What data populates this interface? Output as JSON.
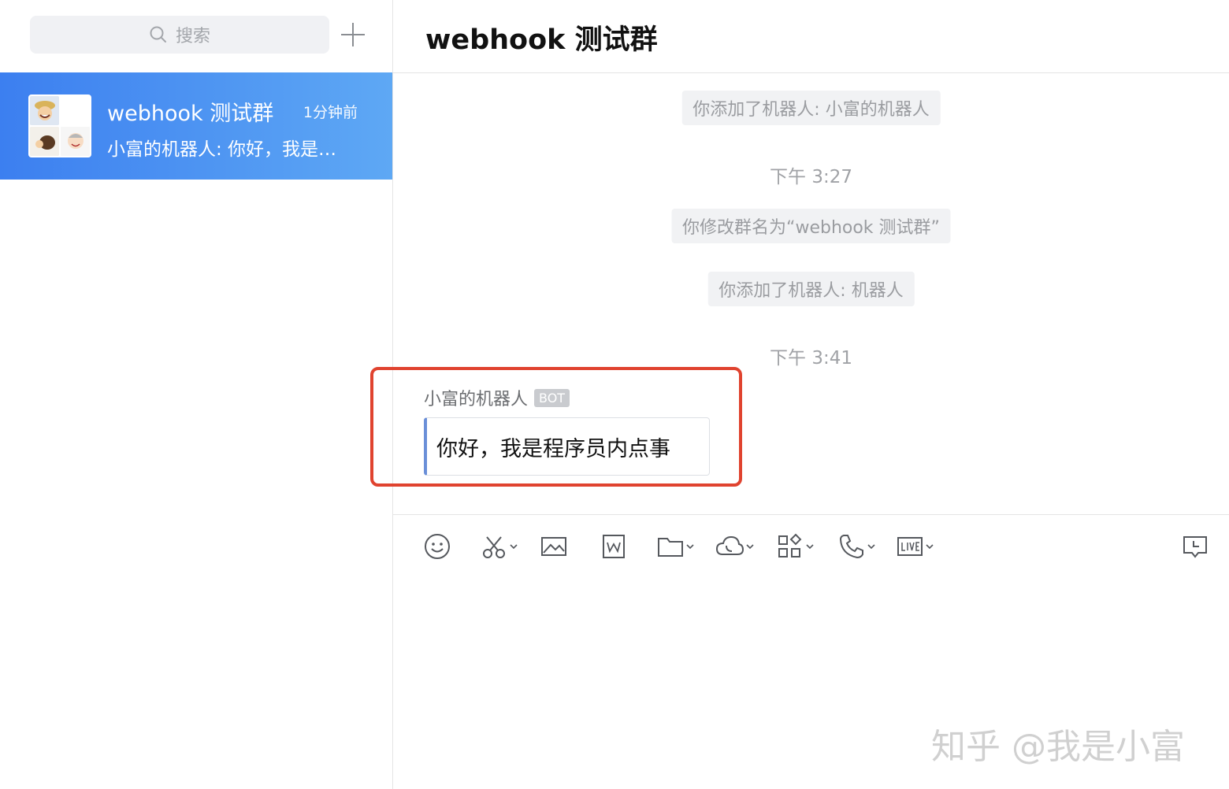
{
  "sidebar": {
    "search_placeholder": "搜索",
    "chat": {
      "title": "webhook 测试群",
      "time": "1分钟前",
      "preview": "小富的机器人: 你好，我是…"
    }
  },
  "header": {
    "title": "webhook 测试群"
  },
  "messages": {
    "notice_1": "你添加了机器人: 小富的机器人",
    "time_1": "下午 3:27",
    "notice_2": "你修改群名为“webhook 测试群”",
    "notice_3": "你添加了机器人: 机器人",
    "time_2": "下午 3:41",
    "sender": "小富的机器人",
    "badge": "BOT",
    "text": "你好，我是程序员内点事"
  },
  "toolbar": {
    "icons": [
      "emoji-icon",
      "scissors-icon",
      "image-icon",
      "word-doc-icon",
      "folder-icon",
      "cloud-icon",
      "apps-icon",
      "phone-icon",
      "live-icon",
      "chat-record-icon"
    ]
  },
  "watermark": "知乎 @我是小富",
  "colors": {
    "selected_chat": "#3c7ff0",
    "highlight": "#e0432f",
    "bubble_accent": "#6a8fd8"
  }
}
